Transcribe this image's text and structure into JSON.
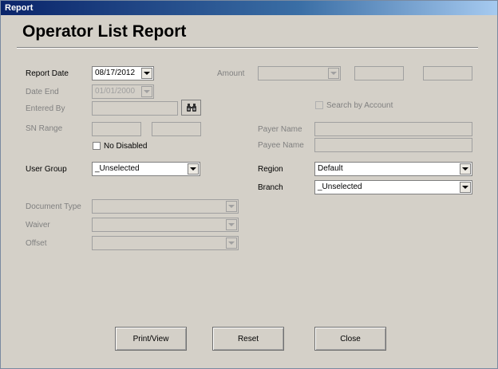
{
  "window": {
    "title": "Report"
  },
  "header": {
    "title": "Operator List Report"
  },
  "form": {
    "report_date": {
      "label": "Report Date",
      "value": "08/17/2012"
    },
    "date_end": {
      "label": "Date End",
      "value": "01/01/2000"
    },
    "entered_by": {
      "label": "Entered By",
      "value": ""
    },
    "sn_range": {
      "label": "SN Range",
      "from": "",
      "to": ""
    },
    "no_disabled": {
      "label": "No Disabled",
      "checked": false
    },
    "user_group": {
      "label": "User Group",
      "value": "_Unselected"
    },
    "document_type": {
      "label": "Document Type",
      "value": ""
    },
    "waiver": {
      "label": "Waiver",
      "value": ""
    },
    "offset": {
      "label": "Offset",
      "value": ""
    },
    "amount": {
      "label": "Amount",
      "value": ""
    },
    "search_by_account": {
      "label": "Search by Account",
      "checked": false
    },
    "payer_name": {
      "label": "Payer Name",
      "value": ""
    },
    "payee_name": {
      "label": "Payee Name",
      "value": ""
    },
    "region": {
      "label": "Region",
      "value": "Default"
    },
    "branch": {
      "label": "Branch",
      "value": "_Unselected"
    }
  },
  "buttons": {
    "print": "Print/View",
    "reset": "Reset",
    "close": "Close"
  },
  "icons": {
    "find": "binoculars-icon",
    "dropdown": "chevron-down-icon"
  }
}
